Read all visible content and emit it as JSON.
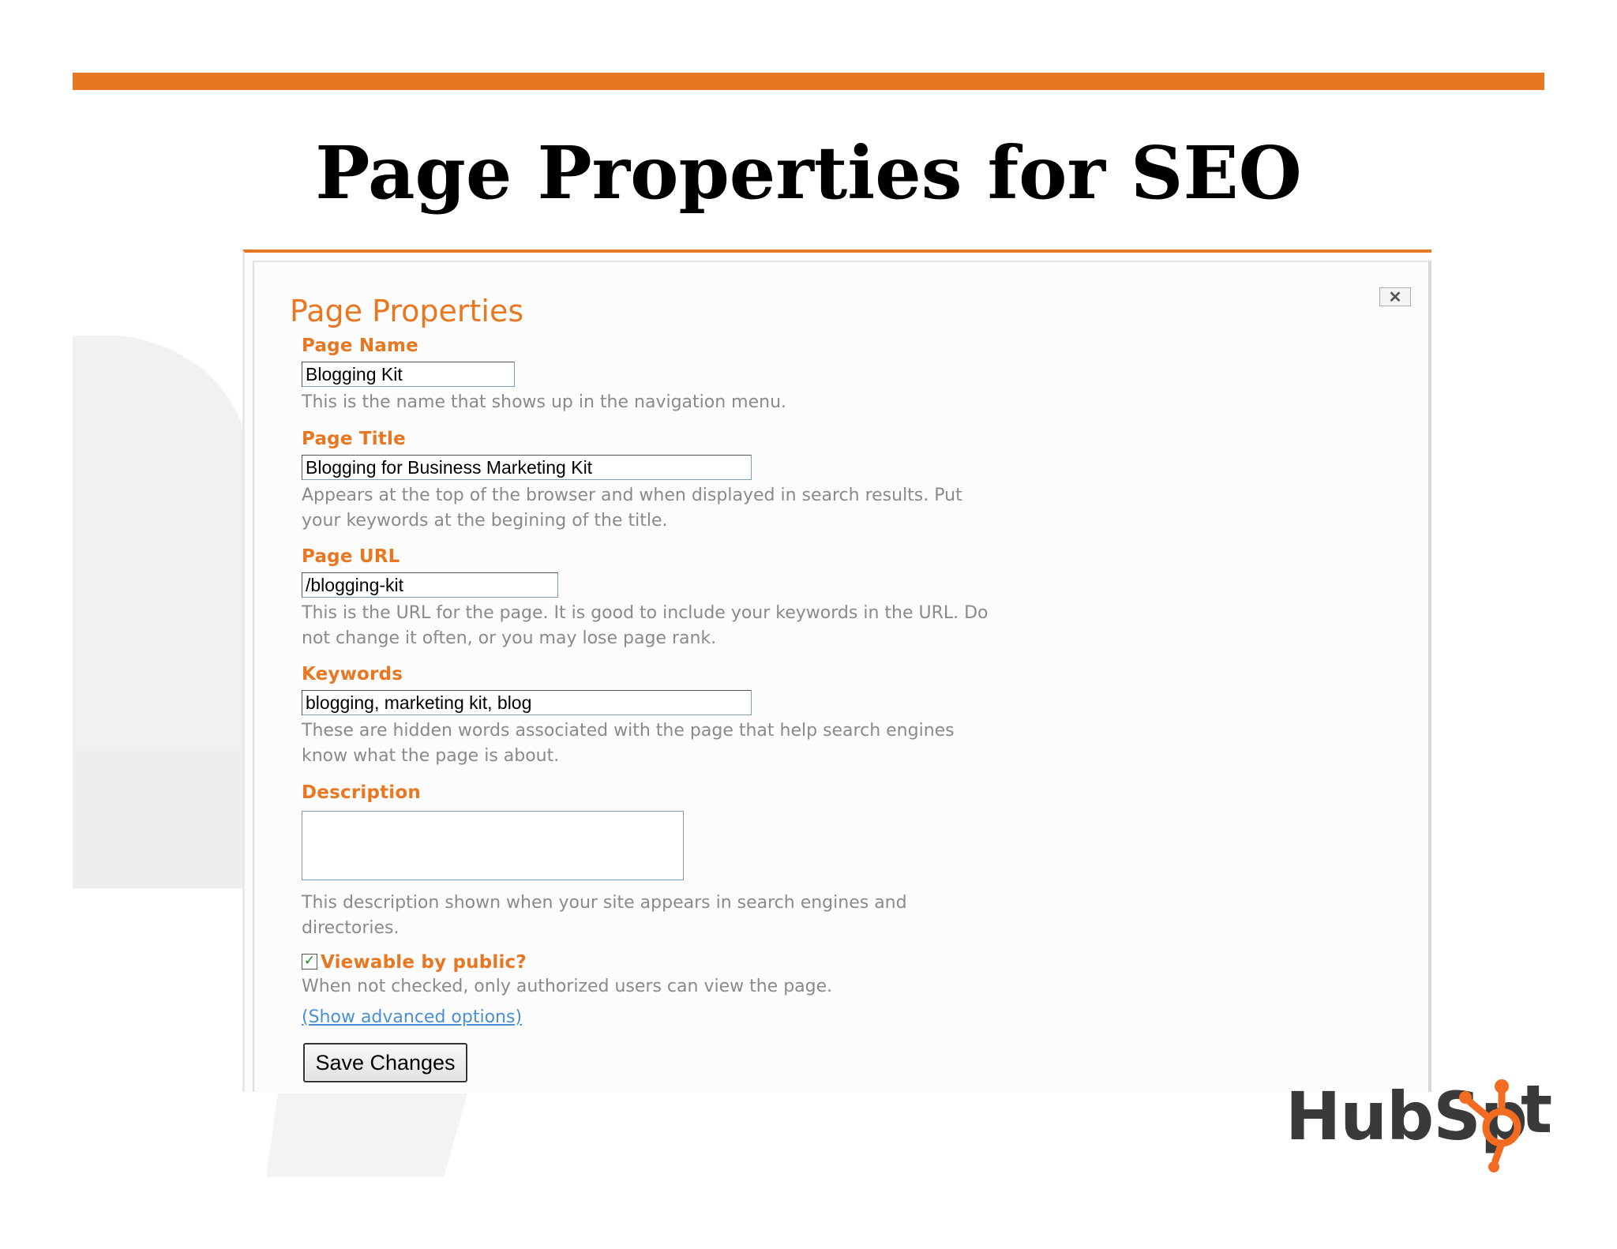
{
  "slide": {
    "title": "Page Properties for SEO"
  },
  "colors": {
    "accent": "#E87722",
    "help_text": "#8a8a8a",
    "link": "#4a8fd6"
  },
  "dialog": {
    "title": "Page Properties",
    "close_label": "✕",
    "fields": {
      "page_name": {
        "label": "Page Name",
        "value": "Blogging Kit",
        "help": "This is the name that shows up in the navigation menu."
      },
      "page_title": {
        "label": "Page Title",
        "value": "Blogging for Business Marketing Kit",
        "help_line1": "Appears at the top of the browser and when displayed in search results. Put",
        "help_line2": "your keywords at the begining of the title."
      },
      "page_url": {
        "label": "Page URL",
        "value": "/blogging-kit",
        "help_line1": "This is the URL for the page. It is good to include your keywords in the URL. Do",
        "help_line2": "not change it often, or you may lose page rank."
      },
      "keywords": {
        "label": "Keywords",
        "value": "blogging, marketing kit, blog",
        "help_line1": "These are hidden words associated with the page that help search engines",
        "help_line2": "know what the page is about."
      },
      "description": {
        "label": "Description",
        "value": "",
        "help_line1": "This description shown when your site appears in search engines and",
        "help_line2": "directories."
      }
    },
    "viewable": {
      "checked": true,
      "check_mark": "✓",
      "label": "Viewable by public?",
      "help": "When not checked, only authorized users can view the page."
    },
    "advanced_link": "(Show advanced options)",
    "save_label": "Save Changes"
  },
  "logo": {
    "text_left": "HubSp",
    "text_right": "t",
    "sprocket_icon": "hubspot-sprocket-icon"
  }
}
